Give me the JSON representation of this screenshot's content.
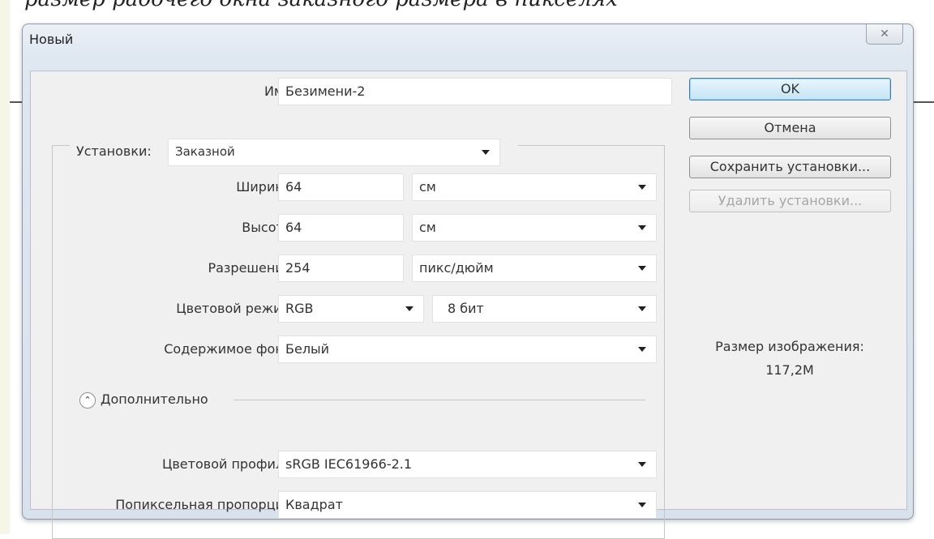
{
  "background_text": "размер рабочего окна заказного размера в пикселях",
  "dialog": {
    "title": "Новый",
    "close_symbol": "✕"
  },
  "form": {
    "name_label": "Имя:",
    "name_value": "Безимени-2",
    "preset_label": "Установки:",
    "preset_value": "Заказной",
    "width_label": "Ширина:",
    "width_value": "64",
    "width_unit": "см",
    "height_label": "Высота:",
    "height_value": "64",
    "height_unit": "см",
    "resolution_label": "Разрешение:",
    "resolution_value": "254",
    "resolution_unit": "пикс/дюйм",
    "color_mode_label": "Цветовой режим:",
    "color_mode_value": "RGB",
    "bit_depth_value": "8 бит",
    "background_label": "Содержимое фона:",
    "background_value": "Белый",
    "advanced_label": "Дополнительно",
    "color_profile_label": "Цветовой профиль:",
    "color_profile_value": "sRGB IEC61966-2.1",
    "pixel_aspect_label": "Попиксельная пропорция:",
    "pixel_aspect_value": "Квадрат"
  },
  "buttons": {
    "ok": "OK",
    "cancel": "Отмена",
    "save_preset": "Сохранить установки...",
    "delete_preset": "Удалить установки..."
  },
  "image_size": {
    "label": "Размер изображения:",
    "value": "117,2M"
  },
  "icons": [
    "close-icon",
    "dropdown-caret-icon",
    "collapse-chevron-icon"
  ],
  "colors": {
    "accent": "#3c7fb1",
    "ok_fill": "#c4e5f6",
    "dialog_bg": "#f0f0f0"
  }
}
